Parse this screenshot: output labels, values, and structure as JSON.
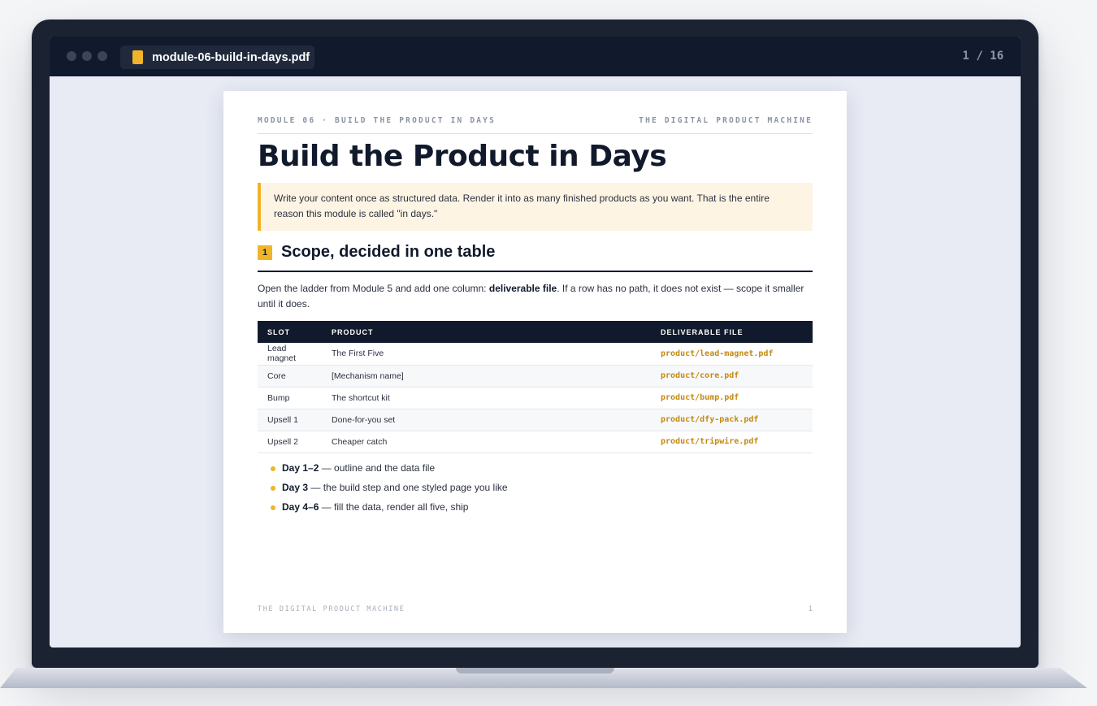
{
  "window": {
    "file_name": "module-06-build-in-days.pdf",
    "page_counter": "1 / 16"
  },
  "page": {
    "header_left": "MODULE 06 · BUILD THE PRODUCT IN DAYS",
    "header_right": "THE DIGITAL PRODUCT MACHINE",
    "title": "Build the Product in Days",
    "callout": "Write your content once as structured data. Render it into as many finished products as you want. That is the entire reason this module is called \"in days.\"",
    "section": {
      "number": "1",
      "title": "Scope, decided in one table"
    },
    "para": {
      "before": "Open the ladder from Module 5 and add one column: ",
      "bold": "deliverable file",
      "after": ". If a row has no path, it does not exist — scope it smaller until it does."
    },
    "table": {
      "headers": [
        "SLOT",
        "PRODUCT",
        "DELIVERABLE FILE"
      ],
      "rows": [
        [
          "Lead magnet",
          "The First Five",
          "product/lead-magnet.pdf"
        ],
        [
          "Core",
          "[Mechanism name]",
          "product/core.pdf"
        ],
        [
          "Bump",
          "The shortcut kit",
          "product/bump.pdf"
        ],
        [
          "Upsell 1",
          "Done-for-you set",
          "product/dfy-pack.pdf"
        ],
        [
          "Upsell 2",
          "Cheaper catch",
          "product/tripwire.pdf"
        ]
      ]
    },
    "bullets": [
      {
        "bold": "Day 1–2",
        "text": " — outline and the data file"
      },
      {
        "bold": "Day 3",
        "text": " — the build step and one styled page you like"
      },
      {
        "bold": "Day 4–6",
        "text": " — fill the data, render all five, ship"
      }
    ],
    "footer_left": "THE DIGITAL PRODUCT MACHINE",
    "footer_right": "1"
  },
  "colors": {
    "accent": "#f0b429",
    "navy": "#111a2c",
    "file_path": "#c28a14",
    "callout_bg": "#fdf4e3"
  },
  "icons": {
    "file": "pdf-file-icon"
  }
}
